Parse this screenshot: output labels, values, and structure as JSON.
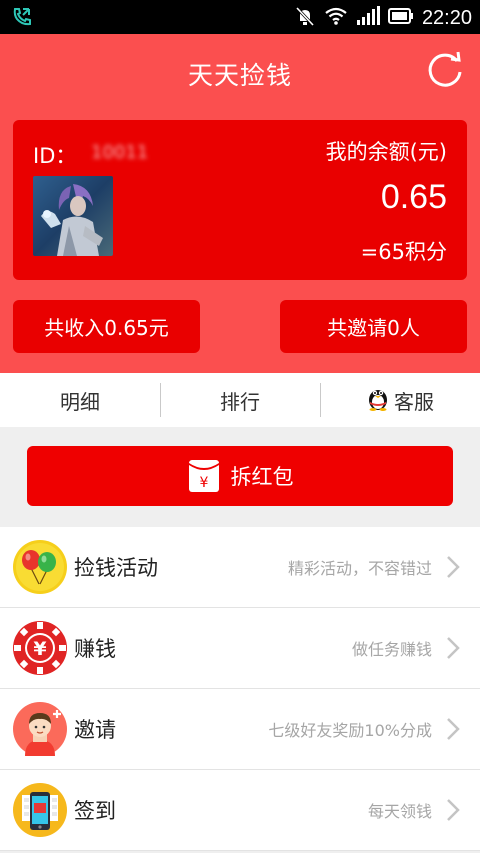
{
  "status_bar": {
    "time": "22:20"
  },
  "header": {
    "title": "天天捡钱"
  },
  "account": {
    "id_label": "ID：",
    "id_value": "10011",
    "balance_label": "我的余额(元)",
    "balance_amount": "0.65",
    "balance_points": "=65积分"
  },
  "stats": {
    "income": "共收入0.65元",
    "invite": "共邀请0人"
  },
  "tabs": [
    {
      "label": "明细"
    },
    {
      "label": "排行"
    },
    {
      "label": "客服",
      "icon": "qq-penguin-icon"
    }
  ],
  "packet_button": {
    "label": "拆红包",
    "icon_char": "¥"
  },
  "list": [
    {
      "title": "捡钱活动",
      "desc": "精彩活动，不容错过",
      "icon": "balloons-icon"
    },
    {
      "title": "赚钱",
      "desc": "做任务赚钱",
      "icon": "yen-chip-icon",
      "icon_char": "¥"
    },
    {
      "title": "邀请",
      "desc": "七级好友奖励10%分成",
      "icon": "invite-person-icon"
    },
    {
      "title": "签到",
      "desc": "每天领钱",
      "icon": "phone-calendar-icon"
    }
  ],
  "colors": {
    "header_red": "#fb4f4f",
    "card_red": "#e90000",
    "button_red": "#ef0000"
  }
}
